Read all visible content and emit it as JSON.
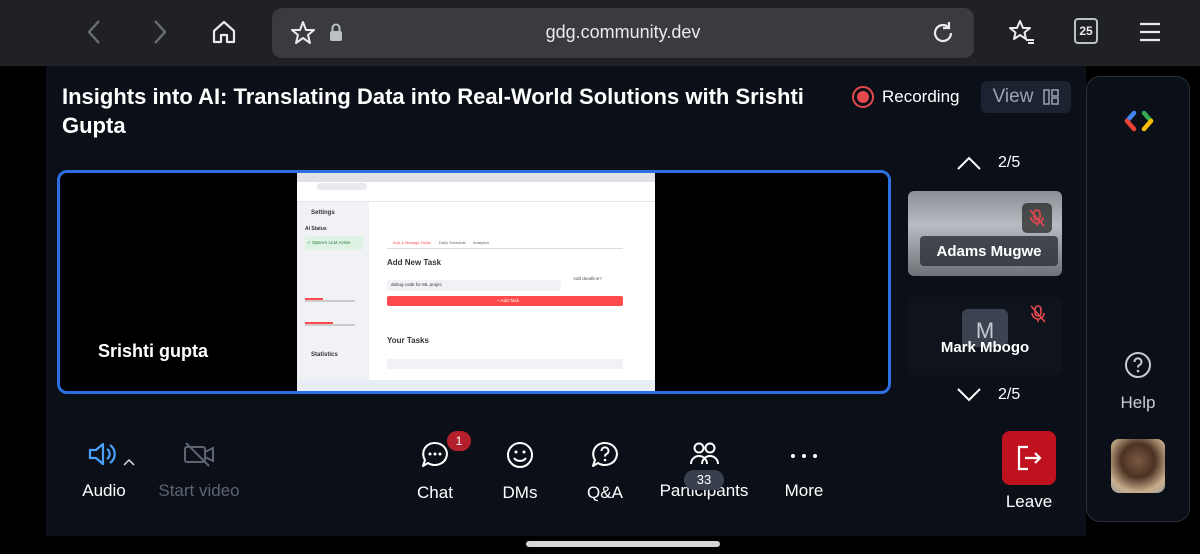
{
  "browser": {
    "url": "gdg.community.dev",
    "tab_count": "25"
  },
  "meeting": {
    "title": "Insights into AI: Translating Data into Real-World Solutions with Srishti Gupta",
    "recording_label": "Recording",
    "view_label": "View",
    "presenter_name": "Srishti gupta"
  },
  "screen_share": {
    "settings": "Settings",
    "ai_status": "AI Status",
    "ai_active": "✓ OpenAI LLM Active",
    "new_task_heading": "Add New Task",
    "task_input_value": "debug code for ML projec",
    "add_task_btn": "+ Add Task",
    "your_tasks": "Your Tasks",
    "statistics": "Statistics",
    "tab_manage": "Add & Manage Tasks",
    "tab_schedule": "Daily Schedule",
    "tab_analytics": "Analytics",
    "deadline_label": "Add deadline?"
  },
  "participants": {
    "page_indicator": "2/5",
    "tiles": [
      {
        "name": "Adams Mugwe"
      },
      {
        "name": "Mark Mbogo",
        "initial": "M"
      }
    ]
  },
  "toolbar": {
    "audio": "Audio",
    "start_video": "Start video",
    "chat": "Chat",
    "chat_badge": "1",
    "dms": "DMs",
    "qa": "Q&A",
    "participants": "Participants",
    "participants_count": "33",
    "more": "More",
    "leave": "Leave"
  },
  "rail": {
    "help": "Help"
  },
  "colors": {
    "accent": "#2d6fe0",
    "recording": "#e5484d",
    "leave": "#c0121e",
    "audio_active": "#4aa3ff"
  }
}
